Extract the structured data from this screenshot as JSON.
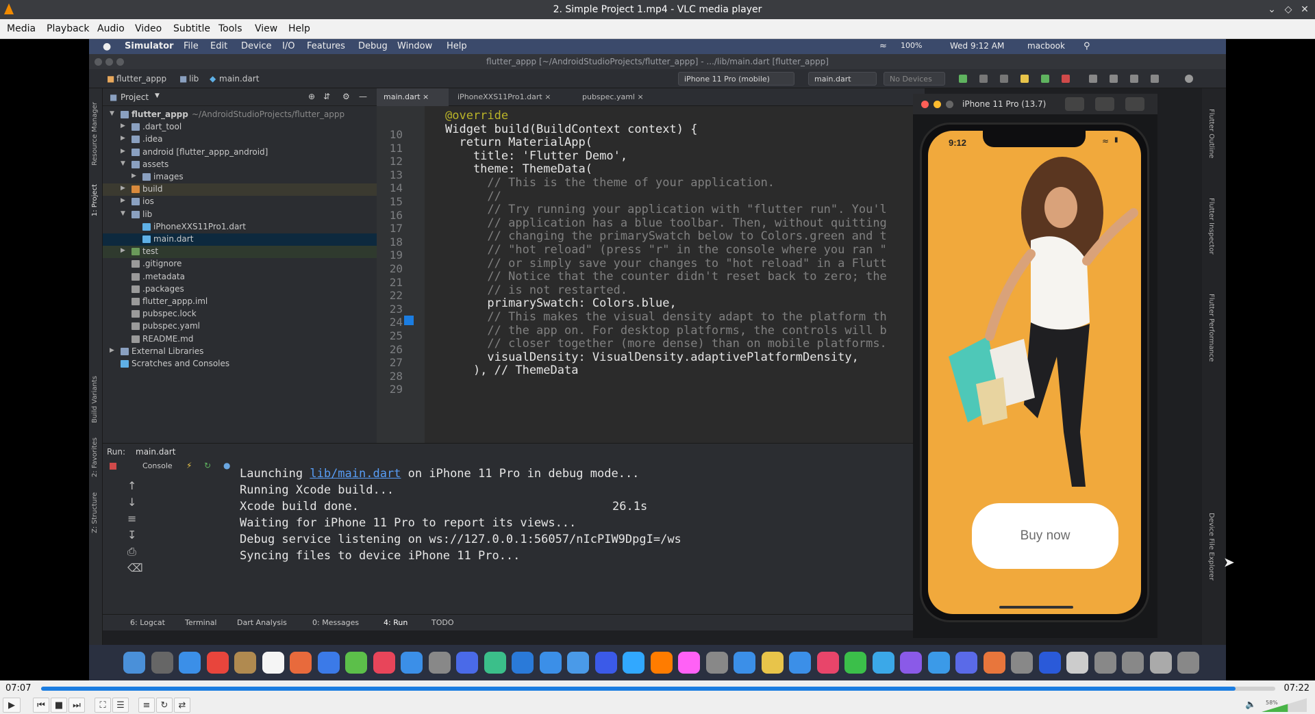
{
  "window": {
    "title": "2. Simple Project 1.mp4 - VLC media player"
  },
  "menu": [
    "Media",
    "Playback",
    "Audio",
    "Video",
    "Subtitle",
    "Tools",
    "View",
    "Help"
  ],
  "mac_menu": {
    "items": [
      "Simulator",
      "File",
      "Edit",
      "Device",
      "I/O",
      "Features",
      "Debug",
      "Window",
      "Help"
    ],
    "status": "100%",
    "clock": "Wed 9:12 AM",
    "user": "macbook"
  },
  "ide": {
    "title": "flutter_appp [~/AndroidStudioProjects/flutter_appp] - .../lib/main.dart [flutter_appp]",
    "breadcrumb": [
      "flutter_appp",
      "lib",
      "main.dart"
    ],
    "device_selector": "iPhone 11 Pro (mobile)",
    "run_config": "main.dart",
    "devices": "No Devices",
    "project_label": "Project",
    "tree": [
      {
        "label": "flutter_appp",
        "suffix": "~/AndroidStudioProjects/flutter_appp",
        "depth": 0,
        "open": true,
        "type": "folder"
      },
      {
        "label": ".dart_tool",
        "depth": 1,
        "open": false,
        "type": "folder"
      },
      {
        "label": ".idea",
        "depth": 1,
        "open": false,
        "type": "folder"
      },
      {
        "label": "android [flutter_appp_android]",
        "depth": 1,
        "open": false,
        "type": "folder"
      },
      {
        "label": "assets",
        "depth": 1,
        "open": true,
        "type": "folder"
      },
      {
        "label": "images",
        "depth": 2,
        "open": false,
        "type": "folder"
      },
      {
        "label": "build",
        "depth": 1,
        "open": false,
        "type": "folder-orange"
      },
      {
        "label": "ios",
        "depth": 1,
        "open": false,
        "type": "folder"
      },
      {
        "label": "lib",
        "depth": 1,
        "open": true,
        "type": "folder"
      },
      {
        "label": "iPhoneXXS11Pro1.dart",
        "depth": 2,
        "type": "dart"
      },
      {
        "label": "main.dart",
        "depth": 2,
        "type": "dart",
        "selected": true
      },
      {
        "label": "test",
        "depth": 1,
        "open": false,
        "type": "folder-green"
      },
      {
        "label": ".gitignore",
        "depth": 1,
        "type": "file"
      },
      {
        "label": ".metadata",
        "depth": 1,
        "type": "file"
      },
      {
        "label": ".packages",
        "depth": 1,
        "type": "file"
      },
      {
        "label": "flutter_appp.iml",
        "depth": 1,
        "type": "file"
      },
      {
        "label": "pubspec.lock",
        "depth": 1,
        "type": "file"
      },
      {
        "label": "pubspec.yaml",
        "depth": 1,
        "type": "file"
      },
      {
        "label": "README.md",
        "depth": 1,
        "type": "file"
      },
      {
        "label": "External Libraries",
        "depth": 0,
        "open": false,
        "type": "lib"
      },
      {
        "label": "Scratches and Consoles",
        "depth": 0,
        "type": "scratch"
      }
    ],
    "tabs": [
      "main.dart",
      "iPhoneXXS11Pro1.dart",
      "pubspec.yaml"
    ],
    "code": [
      {
        "n": "10",
        "t": "@override"
      },
      {
        "n": "11",
        "t": "Widget build(BuildContext context) {"
      },
      {
        "n": "12",
        "t": "  return MaterialApp("
      },
      {
        "n": "13",
        "t": "    title: 'Flutter Demo',"
      },
      {
        "n": "14",
        "t": "    theme: ThemeData("
      },
      {
        "n": "15",
        "t": "      // This is the theme of your application."
      },
      {
        "n": "16",
        "t": "      //"
      },
      {
        "n": "17",
        "t": "      // Try running your application with \"flutter run\". You'l"
      },
      {
        "n": "18",
        "t": "      // application has a blue toolbar. Then, without quitting"
      },
      {
        "n": "19",
        "t": "      // changing the primarySwatch below to Colors.green and t"
      },
      {
        "n": "20",
        "t": "      // \"hot reload\" (press \"r\" in the console where you ran \""
      },
      {
        "n": "21",
        "t": "      // or simply save your changes to \"hot reload\" in a Flutt"
      },
      {
        "n": "22",
        "t": "      // Notice that the counter didn't reset back to zero; the"
      },
      {
        "n": "23",
        "t": "      // is not restarted."
      },
      {
        "n": "24",
        "t": "      primarySwatch: Colors.blue,"
      },
      {
        "n": "25",
        "t": "      // This makes the visual density adapt to the platform th"
      },
      {
        "n": "26",
        "t": "      // the app on. For desktop platforms, the controls will b"
      },
      {
        "n": "27",
        "t": "      // closer together (more dense) than on mobile platforms."
      },
      {
        "n": "28",
        "t": "      visualDensity: VisualDensity.adaptivePlatformDensity,"
      },
      {
        "n": "29",
        "t": "    ), // ThemeData"
      }
    ],
    "run_label": "Run:",
    "run_tab": "main.dart",
    "console_tab": "Console",
    "console": [
      "Launching ",
      "Running Xcode build...",
      "Xcode build done.",
      "Waiting for iPhone 11 Pro to report its views...",
      "Debug service listening on ws://127.0.0.1:56057/nIcPIW9DpgI=/ws",
      "Syncing files to device iPhone 11 Pro..."
    ],
    "console_link": "lib/main.dart",
    "console_launch_tail": " on iPhone 11 Pro in debug mode...",
    "build_time": "26.1s",
    "bottom_tabs": [
      "6: Logcat",
      "Terminal",
      "Dart Analysis",
      "0: Messages",
      "4: Run",
      "TODO"
    ],
    "left_tools": [
      "Resource Manager",
      "1: Project",
      "Build Variants",
      "2: Favorites",
      "Z: Structure"
    ],
    "right_tools": [
      "Flutter Outline",
      "Flutter Inspector",
      "Flutter Performance",
      "Device File Explorer"
    ]
  },
  "simulator": {
    "title": "iPhone 11 Pro (13.7)",
    "time": "9:12",
    "button": "Buy now"
  },
  "player": {
    "current": "07:07",
    "total": "07:22",
    "progress": 0.968,
    "volume": "58%"
  },
  "colors": {
    "accent": "#1b7de1",
    "screen": "#f1a93c"
  }
}
